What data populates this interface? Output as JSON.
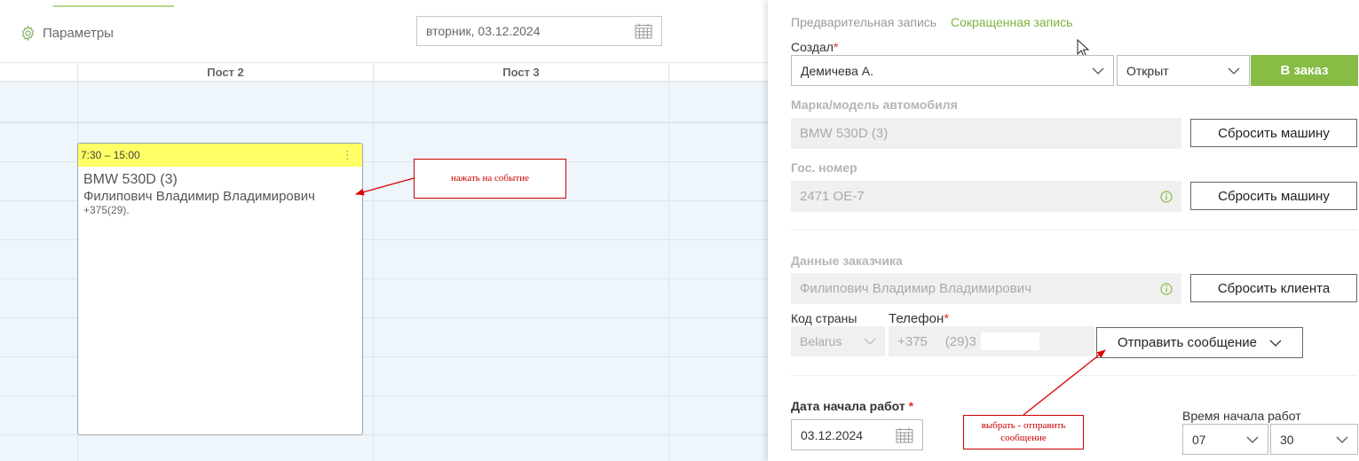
{
  "calendar": {
    "params_label": "Параметры",
    "date_value": "вторник, 03.12.2024",
    "columns": [
      "Пост 2",
      "Пост 3"
    ],
    "event": {
      "time": "7:30 – 15:00",
      "car": "BMW 530D (3)",
      "client": "Филипович Владимир Владимирович",
      "phone": "+375(29)."
    }
  },
  "annotations": {
    "click_event": "нажать на событие",
    "send_message_line1": "выбрать - отправить",
    "send_message_line2": "сообщение"
  },
  "panel": {
    "tabs": [
      "Предварительная запись",
      "Сокращенная запись"
    ],
    "created_by": {
      "label": "Создал",
      "required_mark": "*",
      "value": "Демичева А."
    },
    "status": {
      "value": "Открыт"
    },
    "to_order_button": "В заказ",
    "car_model": {
      "label": "Марка/модель автомобиля",
      "value": "BMW 530D (3)",
      "reset_button": "Сбросить машину"
    },
    "plate": {
      "label": "Гос. номер",
      "value": "2471 ОЕ-7",
      "reset_button": "Сбросить машину"
    },
    "customer": {
      "label": "Данные заказчика",
      "value": "Филипович Владимир Владимирович",
      "reset_button": "Сбросить клиента"
    },
    "country_code": {
      "label": "Код страны",
      "value": "Belarus"
    },
    "phone": {
      "label": "Телефон",
      "required_mark": "*",
      "prefix": "+375",
      "value": "(29)3"
    },
    "send_message_button": "Отправить сообщение",
    "start_date": {
      "label": "Дата начала работ",
      "required_mark": "*",
      "value": "03.12.2024"
    },
    "start_time": {
      "label": "Время начала работ",
      "hour": "07",
      "minute": "30"
    }
  },
  "colors": {
    "accent_green": "#88bc45",
    "tab_green": "#7ab33c",
    "event_yellow": "#ffff66",
    "annotation_red": "#cc0000"
  }
}
